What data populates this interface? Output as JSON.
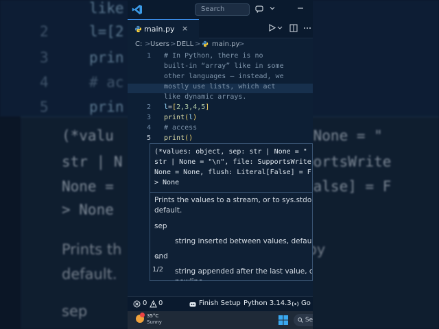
{
  "titlebar": {
    "search_placeholder": "Search"
  },
  "tab": {
    "filename": "main.py",
    "close_glyph": "×"
  },
  "breadcrumb": {
    "drive": "C:",
    "users": "Users",
    "user": "DELL",
    "file": "main.py",
    "separator": ">"
  },
  "editor": {
    "line_numbers": [
      "1",
      "2",
      "3",
      "4",
      "5"
    ],
    "comment_lines": [
      "# In Python, there is no",
      "built-in “array” like in some",
      "other languages — instead, we",
      "mostly use lists, which act",
      "like dynamic arrays."
    ],
    "line2": {
      "var": "l",
      "op": "=",
      "open": "[",
      "values": "2,3,4,5",
      "close": "]"
    },
    "line3": {
      "fn": "print",
      "open": "(",
      "arg": "l",
      "close": ")"
    },
    "line4": "# access",
    "line5": {
      "fn": "print",
      "open": "(",
      "close": ")"
    }
  },
  "hover": {
    "signature_lines": [
      "(*values: object, sep: str | None = \"",
      "str | None = \"\\n\", file: SupportsWrite",
      "None = None, flush: Literal[False] = F",
      "> None"
    ],
    "description_1": "Prints the values to a stream, or to sys.stdout by",
    "description_2": "default.",
    "param_sep": "sep",
    "param_sep_desc": "string inserted between values, default a",
    "param_end": "end",
    "param_end_desc": "string appended after the last value, defa",
    "param_end_desc_2": "newline",
    "pager": "1/2",
    "pager_up": "^"
  },
  "statusbar": {
    "errors": "0",
    "warnings": "0",
    "finish_setup": "Finish Setup",
    "python_version": "Python 3.14.3",
    "go_live": "Go"
  },
  "taskbar": {
    "temperature": "35°C",
    "condition": "Sunny",
    "search_label": "Se"
  },
  "background": {
    "line_numbers": [
      "2",
      "3",
      "4",
      "5"
    ],
    "line_top": "like",
    "line2": "l=[2",
    "line3": "prin",
    "line4": "# ac",
    "line5": "prin",
    "sig1": "(*valu                   r | None = \"",
    "sig2": "str | N                  SupportsWrite",
    "sig3": "None =                   al[False] = F",
    "sig4": "> None",
    "text1": "Prints th                 r to sys.stdout by",
    "text2": "default.",
    "text3": "sep"
  },
  "colors": {
    "accent": "#3b8eea",
    "editor_bg": "#0d1f35",
    "comment": "#7f95ab",
    "function": "#dcdcaa",
    "variable": "#9cdcfe",
    "number": "#b5cea8",
    "bracket": "#f2d36b"
  }
}
